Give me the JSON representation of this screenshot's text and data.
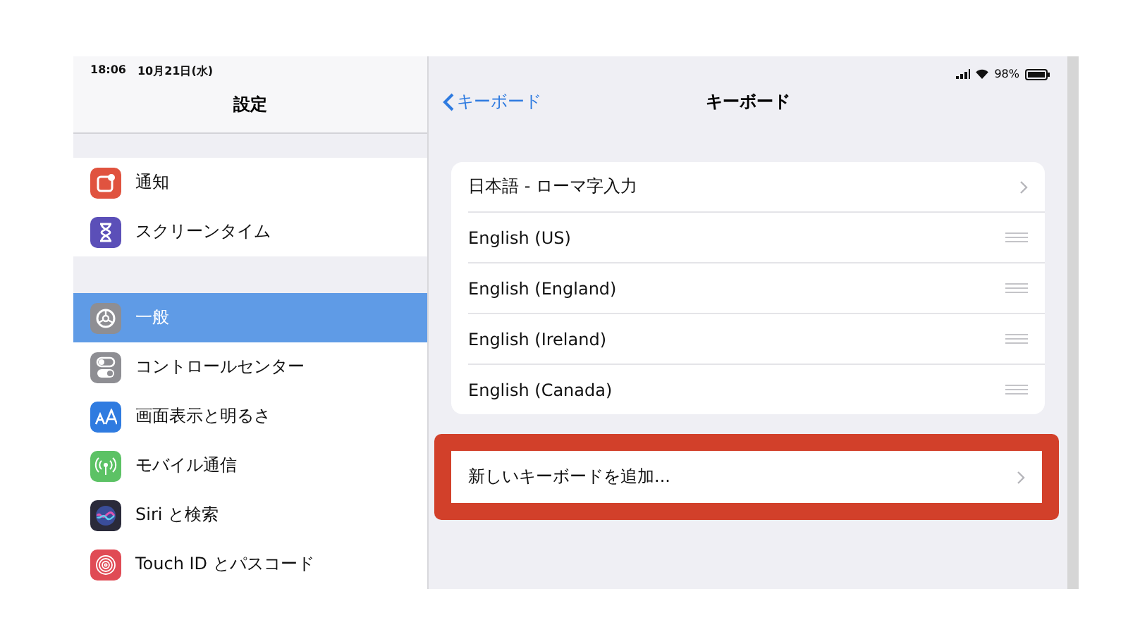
{
  "status_bar": {
    "time": "18:06",
    "date": "10月21日(水)",
    "battery": "98%"
  },
  "sidebar": {
    "title": "設定",
    "groups": [
      {
        "items": [
          {
            "label": "通知",
            "selected": false,
            "kind": "notifications",
            "color": "#e0533f"
          },
          {
            "label": "スクリーンタイム",
            "selected": false,
            "kind": "hourglass",
            "color": "#5b4fb8"
          }
        ]
      },
      {
        "items": [
          {
            "label": "一般",
            "selected": true,
            "kind": "gear",
            "color": "#8e8e93"
          },
          {
            "label": "コントロールセンター",
            "selected": false,
            "kind": "toggles",
            "color": "#8e8e93"
          },
          {
            "label": "画面表示と明るさ",
            "selected": false,
            "kind": "text-size",
            "color": "#2f7be0"
          },
          {
            "label": "モバイル通信",
            "selected": false,
            "kind": "antenna",
            "color": "#5cc265"
          },
          {
            "label": "Siri と検索",
            "selected": false,
            "kind": "siri",
            "color": "#2a2a3a"
          },
          {
            "label": "Touch ID とパスコード",
            "selected": false,
            "kind": "fingerprint",
            "color": "#e04b55"
          }
        ]
      }
    ]
  },
  "detail": {
    "back": "キーボード",
    "title": "キーボード",
    "keyboards": [
      {
        "label": "日本語 - ローマ字入力",
        "kind": "chevron"
      },
      {
        "label": "English (US)",
        "kind": "reorder"
      },
      {
        "label": "English (England)",
        "kind": "reorder"
      },
      {
        "label": "English (Ireland)",
        "kind": "reorder"
      },
      {
        "label": "English (Canada)",
        "kind": "reorder"
      }
    ],
    "add": {
      "label": "新しいキーボードを追加...",
      "highlighted": true
    }
  }
}
